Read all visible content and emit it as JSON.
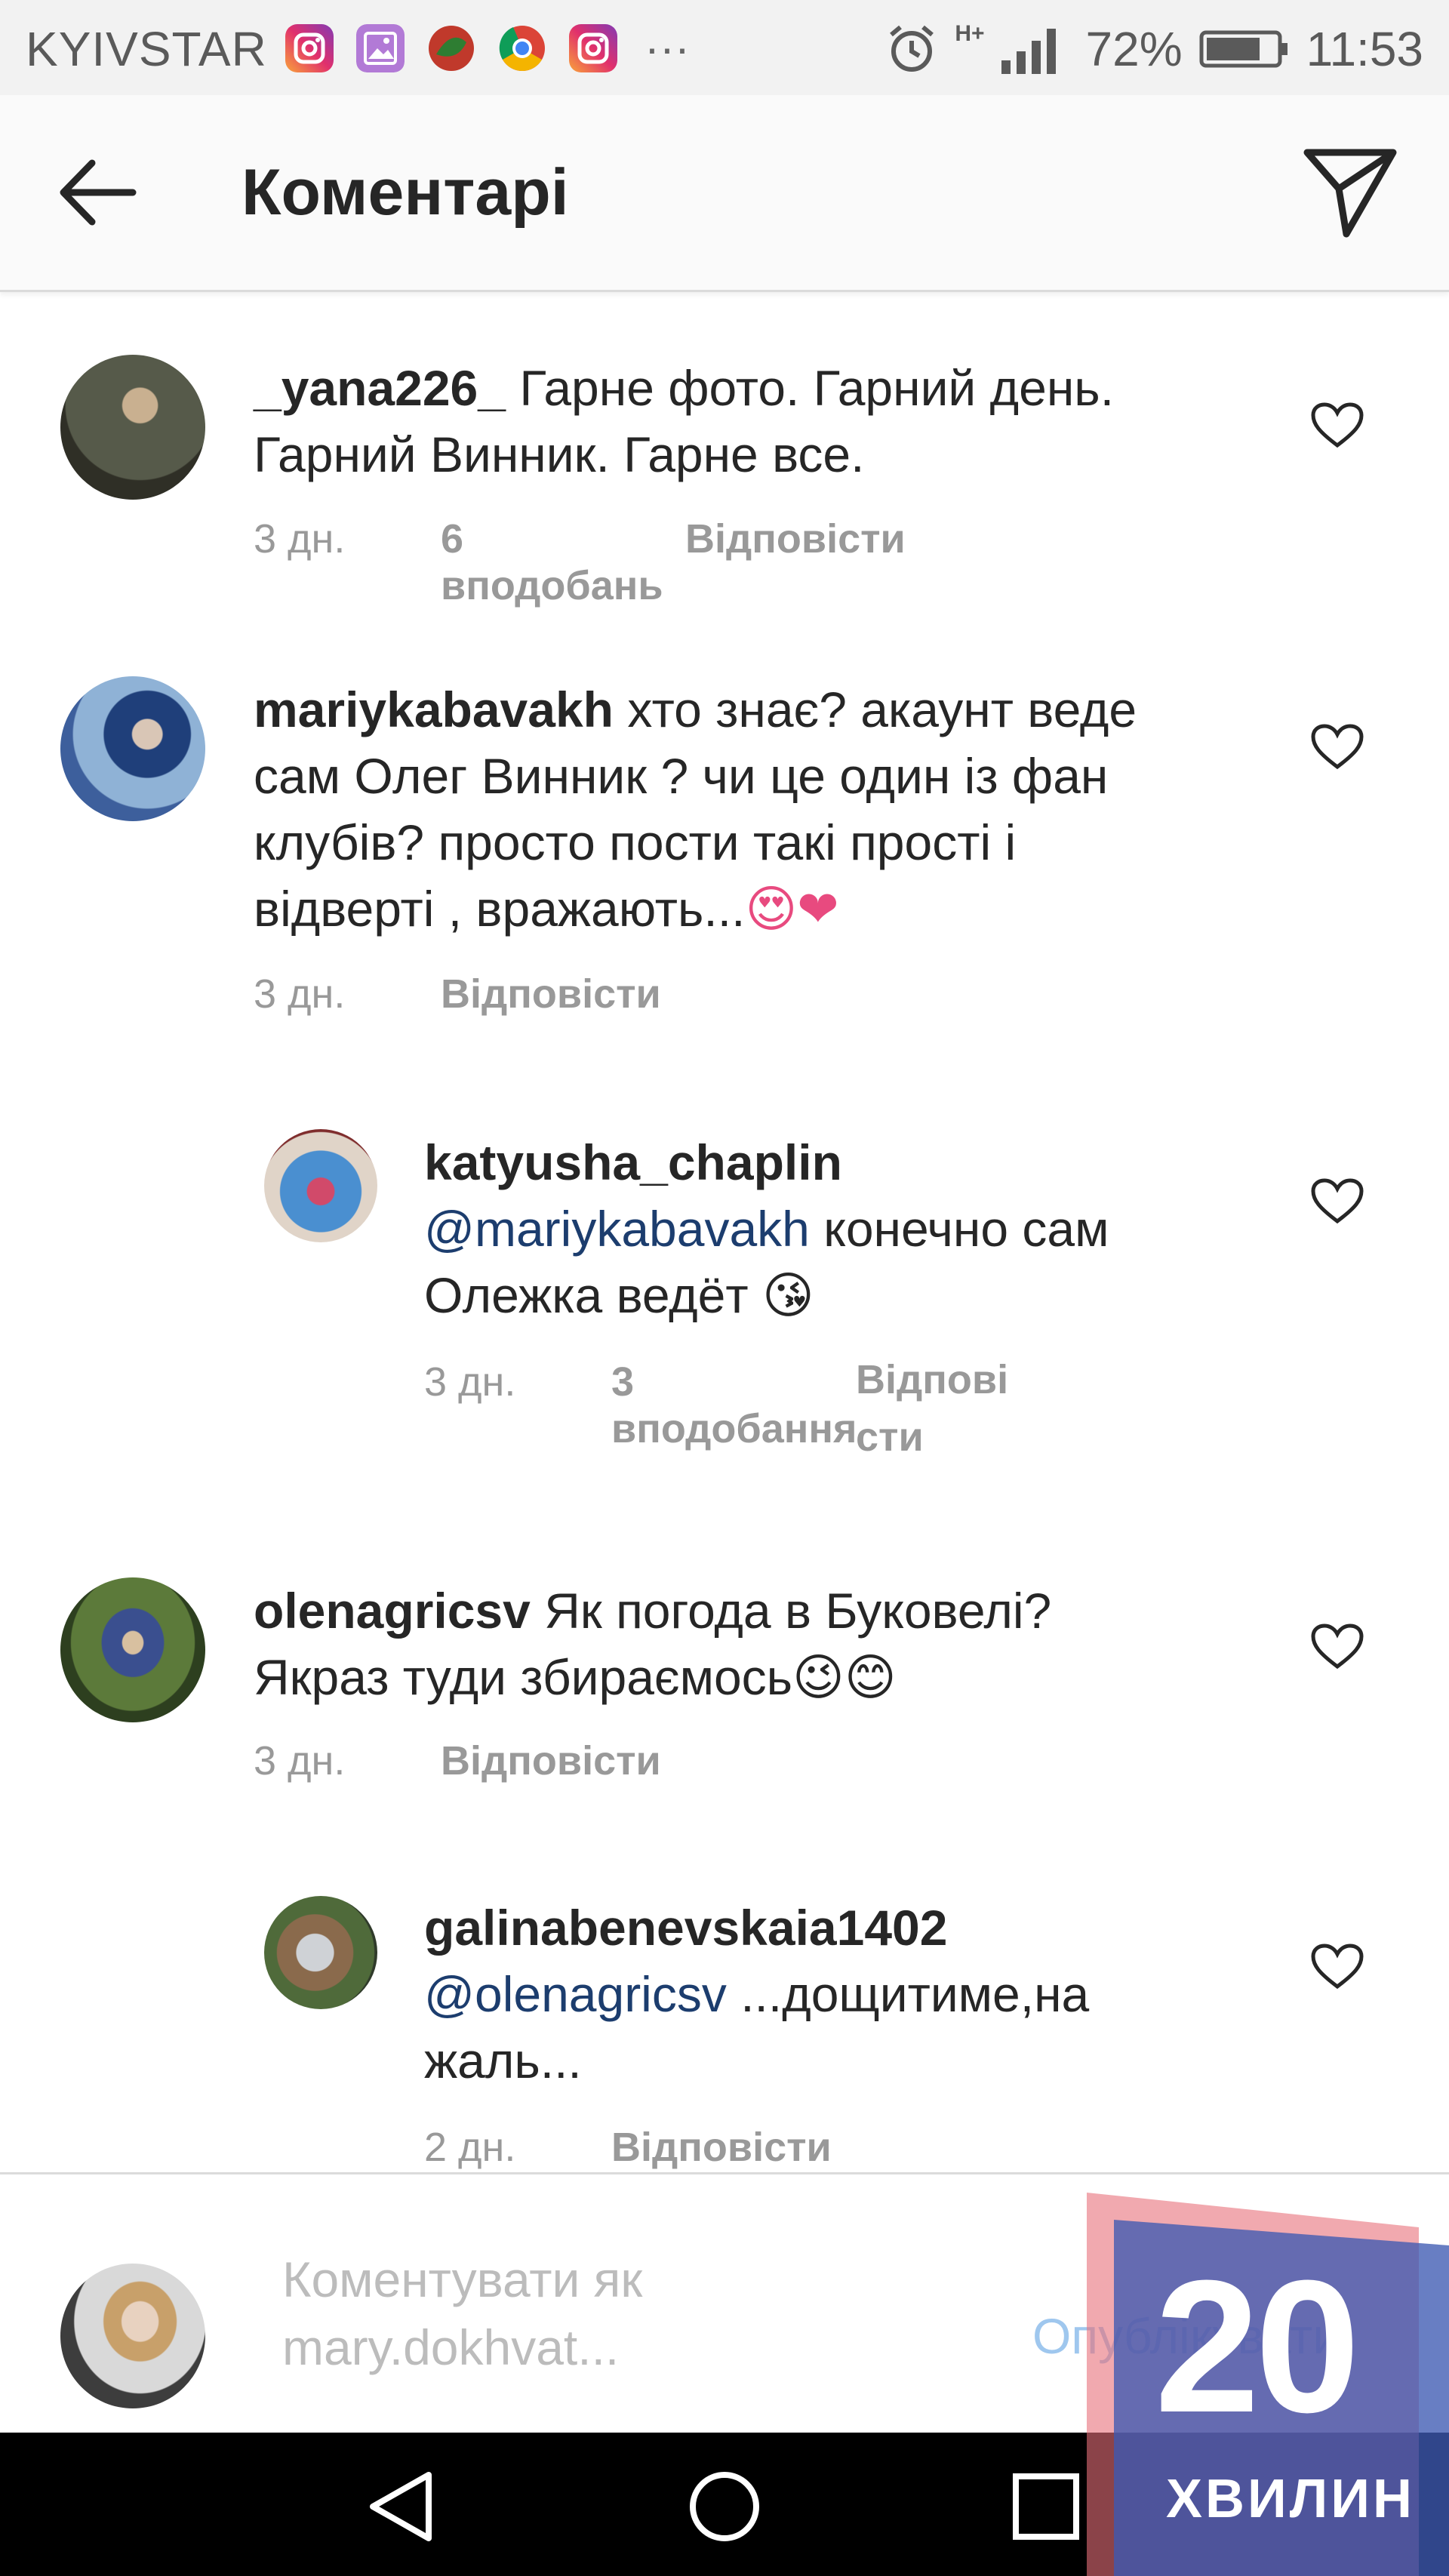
{
  "status_bar": {
    "carrier": "KYIVSTAR",
    "icons": [
      "instagram-icon",
      "gallery-icon",
      "app-icon",
      "chrome-icon",
      "instagram-icon"
    ],
    "more": "···",
    "network": "H+",
    "battery": "72%",
    "time": "11:53"
  },
  "header": {
    "title": "Коментарі",
    "back_icon": "arrow-back-icon",
    "share_icon": "send-icon"
  },
  "comments": [
    {
      "username": "_yana226_",
      "text": "Гарне фото. Гарний день. Гарний Винник. Гарне все.",
      "lines": [
        "Гарне фото. Гарний день.",
        "Гарний Винник. Гарне все."
      ],
      "time": "3 дн.",
      "likes": "6 вподобань",
      "reply": "Відповісти"
    },
    {
      "username": "mariykabavakh",
      "text": "хто знає? акаунт веде сам Олег Винник ? чи це один із фан клубів? просто пости такі прості і відверті , вражають...",
      "lines": [
        "хто знає? акаунт веде",
        "сам Олег Винник ? чи це один із фан",
        "клубів?  просто пости такі прості і",
        "відверті , вражають..."
      ],
      "emoji": "😍❤",
      "time": "3 дн.",
      "reply": "Відповісти"
    },
    {
      "username": "katyusha_chaplin",
      "mention": "@mariykabavakh",
      "text": "конечно сам Олежка ведёт",
      "lines": [
        "конечно сам",
        "Олежка ведёт"
      ],
      "emoji": "😘",
      "time": "3 дн.",
      "likes": "3 вподобання",
      "reply_lines": [
        "Відпові",
        "сти"
      ]
    },
    {
      "username": "olenagricsv",
      "text": "Як погода в Буковелі? Якраз туди збираємось",
      "lines": [
        "Як погода в Буковелі?",
        "Якраз туди збираємось"
      ],
      "emoji": "😉😊",
      "time": "3 дн.",
      "reply": "Відповісти"
    },
    {
      "username": "galinabenevskaia1402",
      "mention": "@olenagricsv",
      "text": "...дощитиме,на жаль...",
      "lines": [
        "...дощитиме,на",
        "жаль..."
      ],
      "time": "2 дн.",
      "reply": "Відповісти"
    }
  ],
  "composer": {
    "placeholder_lines": [
      "Коментувати як",
      "mary.dokhvat..."
    ],
    "publish": "Опублікувати"
  },
  "nav_bar": {
    "back_icon": "nav-back-icon",
    "home_icon": "nav-home-icon",
    "recents_icon": "nav-recents-icon"
  },
  "watermark": {
    "number": "20",
    "word": "ХВИЛИН"
  }
}
